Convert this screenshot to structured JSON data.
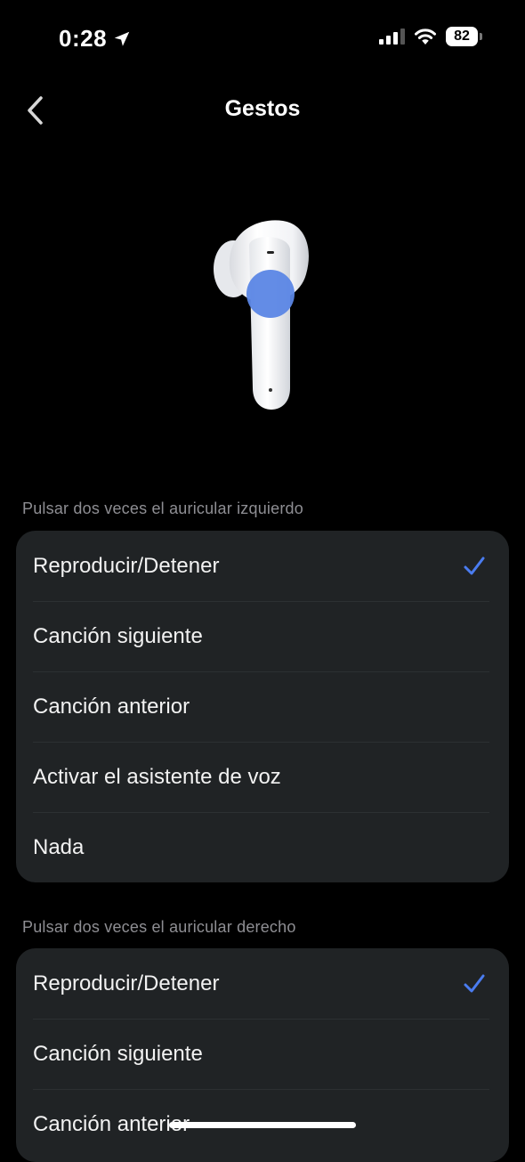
{
  "status_bar": {
    "time": "0:28",
    "battery": "82",
    "icons": [
      "location-arrow-icon",
      "signal-icon",
      "wifi-icon",
      "battery-icon"
    ]
  },
  "nav": {
    "title": "Gestos",
    "back_icon": "chevron-left-icon"
  },
  "illustration": {
    "name": "earbud-illustration",
    "highlight_color": "#5b86e5"
  },
  "sections": [
    {
      "label": "Pulsar dos veces el auricular izquierdo",
      "options": [
        {
          "label": "Reproducir/Detener",
          "selected": true
        },
        {
          "label": "Canción siguiente",
          "selected": false
        },
        {
          "label": "Canción anterior",
          "selected": false
        },
        {
          "label": "Activar el asistente de voz",
          "selected": false
        },
        {
          "label": "Nada",
          "selected": false
        }
      ]
    },
    {
      "label": "Pulsar dos veces el auricular derecho",
      "options": [
        {
          "label": "Reproducir/Detener",
          "selected": true
        },
        {
          "label": "Canción siguiente",
          "selected": false
        },
        {
          "label": "Canción anterior",
          "selected": false
        }
      ]
    }
  ],
  "colors": {
    "background": "#000000",
    "card": "#202325",
    "accent": "#4a7cf0",
    "secondary_text": "#8e8e93"
  }
}
